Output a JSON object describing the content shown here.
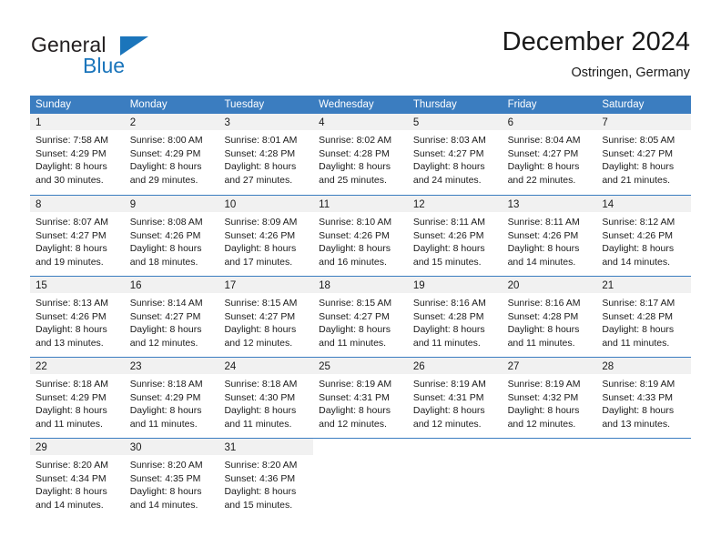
{
  "logo": {
    "word_top": "General",
    "word_bottom": "Blue",
    "triangle_color": "#1b75bb",
    "text_color": "#231f20"
  },
  "header": {
    "title": "December 2024",
    "subtitle": "Ostringen, Germany"
  },
  "colors": {
    "header_blue": "#3b7dc0",
    "day_band_gray": "#f1f1f1",
    "text": "#1a1a1a",
    "white": "#ffffff"
  },
  "weekdays": [
    "Sunday",
    "Monday",
    "Tuesday",
    "Wednesday",
    "Thursday",
    "Friday",
    "Saturday"
  ],
  "weeks": [
    [
      {
        "day": "1",
        "lines": [
          "Sunrise: 7:58 AM",
          "Sunset: 4:29 PM",
          "Daylight: 8 hours",
          "and 30 minutes."
        ]
      },
      {
        "day": "2",
        "lines": [
          "Sunrise: 8:00 AM",
          "Sunset: 4:29 PM",
          "Daylight: 8 hours",
          "and 29 minutes."
        ]
      },
      {
        "day": "3",
        "lines": [
          "Sunrise: 8:01 AM",
          "Sunset: 4:28 PM",
          "Daylight: 8 hours",
          "and 27 minutes."
        ]
      },
      {
        "day": "4",
        "lines": [
          "Sunrise: 8:02 AM",
          "Sunset: 4:28 PM",
          "Daylight: 8 hours",
          "and 25 minutes."
        ]
      },
      {
        "day": "5",
        "lines": [
          "Sunrise: 8:03 AM",
          "Sunset: 4:27 PM",
          "Daylight: 8 hours",
          "and 24 minutes."
        ]
      },
      {
        "day": "6",
        "lines": [
          "Sunrise: 8:04 AM",
          "Sunset: 4:27 PM",
          "Daylight: 8 hours",
          "and 22 minutes."
        ]
      },
      {
        "day": "7",
        "lines": [
          "Sunrise: 8:05 AM",
          "Sunset: 4:27 PM",
          "Daylight: 8 hours",
          "and 21 minutes."
        ]
      }
    ],
    [
      {
        "day": "8",
        "lines": [
          "Sunrise: 8:07 AM",
          "Sunset: 4:27 PM",
          "Daylight: 8 hours",
          "and 19 minutes."
        ]
      },
      {
        "day": "9",
        "lines": [
          "Sunrise: 8:08 AM",
          "Sunset: 4:26 PM",
          "Daylight: 8 hours",
          "and 18 minutes."
        ]
      },
      {
        "day": "10",
        "lines": [
          "Sunrise: 8:09 AM",
          "Sunset: 4:26 PM",
          "Daylight: 8 hours",
          "and 17 minutes."
        ]
      },
      {
        "day": "11",
        "lines": [
          "Sunrise: 8:10 AM",
          "Sunset: 4:26 PM",
          "Daylight: 8 hours",
          "and 16 minutes."
        ]
      },
      {
        "day": "12",
        "lines": [
          "Sunrise: 8:11 AM",
          "Sunset: 4:26 PM",
          "Daylight: 8 hours",
          "and 15 minutes."
        ]
      },
      {
        "day": "13",
        "lines": [
          "Sunrise: 8:11 AM",
          "Sunset: 4:26 PM",
          "Daylight: 8 hours",
          "and 14 minutes."
        ]
      },
      {
        "day": "14",
        "lines": [
          "Sunrise: 8:12 AM",
          "Sunset: 4:26 PM",
          "Daylight: 8 hours",
          "and 14 minutes."
        ]
      }
    ],
    [
      {
        "day": "15",
        "lines": [
          "Sunrise: 8:13 AM",
          "Sunset: 4:26 PM",
          "Daylight: 8 hours",
          "and 13 minutes."
        ]
      },
      {
        "day": "16",
        "lines": [
          "Sunrise: 8:14 AM",
          "Sunset: 4:27 PM",
          "Daylight: 8 hours",
          "and 12 minutes."
        ]
      },
      {
        "day": "17",
        "lines": [
          "Sunrise: 8:15 AM",
          "Sunset: 4:27 PM",
          "Daylight: 8 hours",
          "and 12 minutes."
        ]
      },
      {
        "day": "18",
        "lines": [
          "Sunrise: 8:15 AM",
          "Sunset: 4:27 PM",
          "Daylight: 8 hours",
          "and 11 minutes."
        ]
      },
      {
        "day": "19",
        "lines": [
          "Sunrise: 8:16 AM",
          "Sunset: 4:28 PM",
          "Daylight: 8 hours",
          "and 11 minutes."
        ]
      },
      {
        "day": "20",
        "lines": [
          "Sunrise: 8:16 AM",
          "Sunset: 4:28 PM",
          "Daylight: 8 hours",
          "and 11 minutes."
        ]
      },
      {
        "day": "21",
        "lines": [
          "Sunrise: 8:17 AM",
          "Sunset: 4:28 PM",
          "Daylight: 8 hours",
          "and 11 minutes."
        ]
      }
    ],
    [
      {
        "day": "22",
        "lines": [
          "Sunrise: 8:18 AM",
          "Sunset: 4:29 PM",
          "Daylight: 8 hours",
          "and 11 minutes."
        ]
      },
      {
        "day": "23",
        "lines": [
          "Sunrise: 8:18 AM",
          "Sunset: 4:29 PM",
          "Daylight: 8 hours",
          "and 11 minutes."
        ]
      },
      {
        "day": "24",
        "lines": [
          "Sunrise: 8:18 AM",
          "Sunset: 4:30 PM",
          "Daylight: 8 hours",
          "and 11 minutes."
        ]
      },
      {
        "day": "25",
        "lines": [
          "Sunrise: 8:19 AM",
          "Sunset: 4:31 PM",
          "Daylight: 8 hours",
          "and 12 minutes."
        ]
      },
      {
        "day": "26",
        "lines": [
          "Sunrise: 8:19 AM",
          "Sunset: 4:31 PM",
          "Daylight: 8 hours",
          "and 12 minutes."
        ]
      },
      {
        "day": "27",
        "lines": [
          "Sunrise: 8:19 AM",
          "Sunset: 4:32 PM",
          "Daylight: 8 hours",
          "and 12 minutes."
        ]
      },
      {
        "day": "28",
        "lines": [
          "Sunrise: 8:19 AM",
          "Sunset: 4:33 PM",
          "Daylight: 8 hours",
          "and 13 minutes."
        ]
      }
    ],
    [
      {
        "day": "29",
        "lines": [
          "Sunrise: 8:20 AM",
          "Sunset: 4:34 PM",
          "Daylight: 8 hours",
          "and 14 minutes."
        ]
      },
      {
        "day": "30",
        "lines": [
          "Sunrise: 8:20 AM",
          "Sunset: 4:35 PM",
          "Daylight: 8 hours",
          "and 14 minutes."
        ]
      },
      {
        "day": "31",
        "lines": [
          "Sunrise: 8:20 AM",
          "Sunset: 4:36 PM",
          "Daylight: 8 hours",
          "and 15 minutes."
        ]
      },
      {
        "day": "",
        "lines": []
      },
      {
        "day": "",
        "lines": []
      },
      {
        "day": "",
        "lines": []
      },
      {
        "day": "",
        "lines": []
      }
    ]
  ]
}
